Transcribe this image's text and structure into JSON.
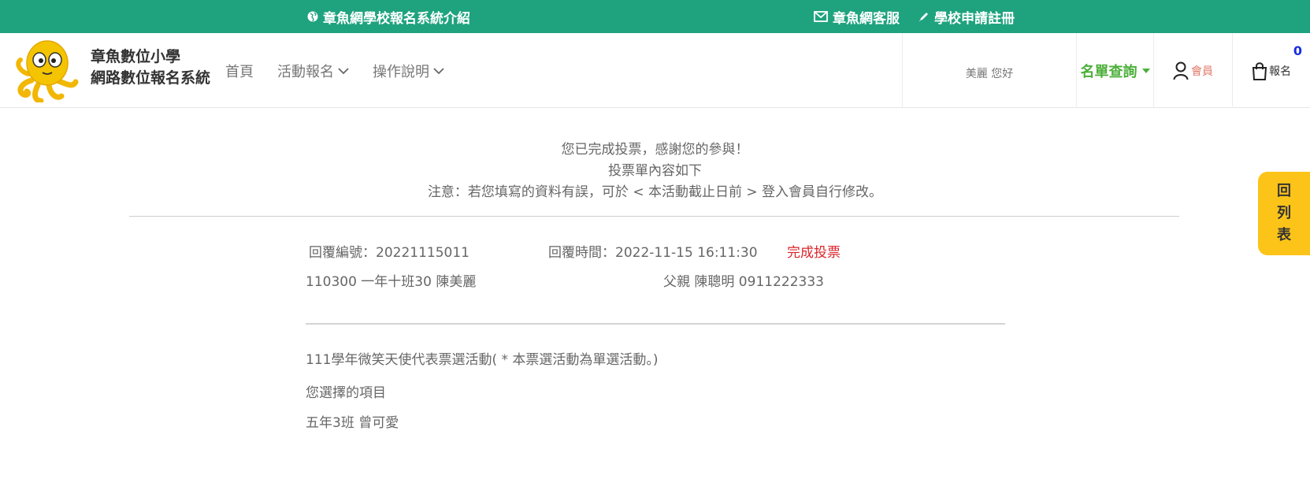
{
  "topbar": {
    "intro": "章魚網學校報名系統介紹",
    "service": "章魚網客服",
    "register": "學校申請註冊",
    "color": "#1fa37f"
  },
  "header": {
    "brand_line1": "章魚數位小學",
    "brand_line2": "網路數位報名系統",
    "nav": {
      "home": "首頁",
      "activity": "活動報名",
      "guide": "操作說明"
    },
    "greeting": "美麗 您好",
    "list_query": "名單查詢",
    "member": "會員",
    "signup": "報名",
    "cart_count": "0"
  },
  "message": {
    "line1": "您已完成投票，感謝您的參與！",
    "line2": "投票單內容如下",
    "line3": "注意：若您填寫的資料有誤，可於 < 本活動截止日前 > 登入會員自行修改。"
  },
  "reply": {
    "number_label": "回覆編號：20221115011",
    "time_label": "回覆時間：2022-11-15 16:11:30",
    "status": "完成投票",
    "student": "110300 一年十班30 陳美麗",
    "parent": "父親 陳聰明 0911222333"
  },
  "vote": {
    "activity": "111學年微笑天使代表票選活動( * 本票選活動為單選活動。)",
    "choice_label": "您選擇的項目",
    "choice_value": "五年3班 曾可愛"
  },
  "sidetab": {
    "chars": [
      "回",
      "列",
      "表"
    ]
  },
  "colors": {
    "accent_green": "#1fa37f",
    "list_green": "#4caf3a",
    "status_red": "#d9262c",
    "tab_yellow": "#fcc419",
    "cart_blue": "#1a2ee0"
  }
}
